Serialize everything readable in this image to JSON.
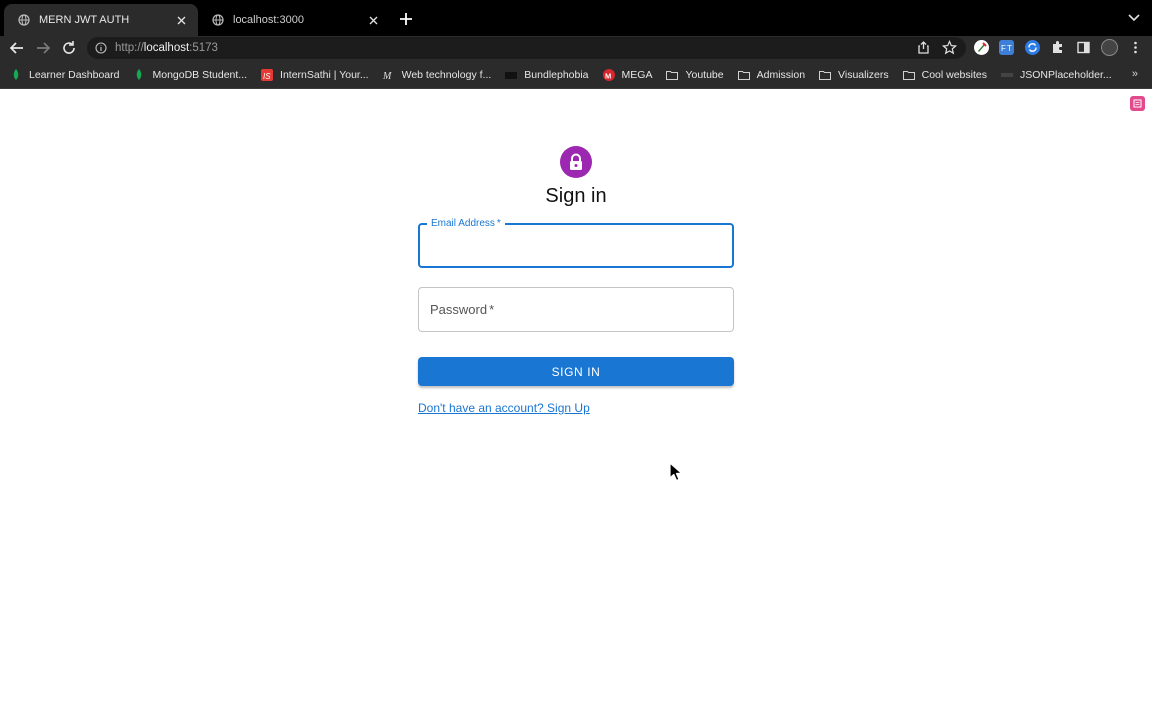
{
  "browser": {
    "tabs": [
      {
        "title": "MERN JWT AUTH",
        "active": true
      },
      {
        "title": "localhost:3000",
        "active": false
      }
    ],
    "url": {
      "scheme": "http://",
      "host": "localhost",
      "port": ":5173"
    },
    "bookmarks": [
      {
        "label": "Learner Dashboard",
        "icon": "leaf-icon"
      },
      {
        "label": "MongoDB Student...",
        "icon": "leaf-icon"
      },
      {
        "label": "InternSathi | Your...",
        "icon": "is-logo-icon"
      },
      {
        "label": "Web technology f...",
        "icon": "m-logo-icon"
      },
      {
        "label": "Bundlephobia",
        "icon": "box-icon"
      },
      {
        "label": "MEGA",
        "icon": "mega-icon"
      },
      {
        "label": "Youtube",
        "icon": "folder-icon"
      },
      {
        "label": "Admission",
        "icon": "folder-icon"
      },
      {
        "label": "Visualizers",
        "icon": "folder-icon"
      },
      {
        "label": "Cool websites",
        "icon": "folder-icon"
      },
      {
        "label": "JSONPlaceholder...",
        "icon": "json-icon"
      }
    ],
    "bookmarks_overflow": "»"
  },
  "page": {
    "title": "Sign in",
    "email": {
      "label": "Email Address",
      "required_mark": "*",
      "value": ""
    },
    "password": {
      "label": "Password",
      "required_mark": "*",
      "value": ""
    },
    "submit_label": "SIGN IN",
    "signup_link": "Don't have an account? Sign Up"
  },
  "colors": {
    "primary": "#1976d2",
    "avatar": "#9c27b0",
    "chrome_bg": "#2b2b2b"
  }
}
